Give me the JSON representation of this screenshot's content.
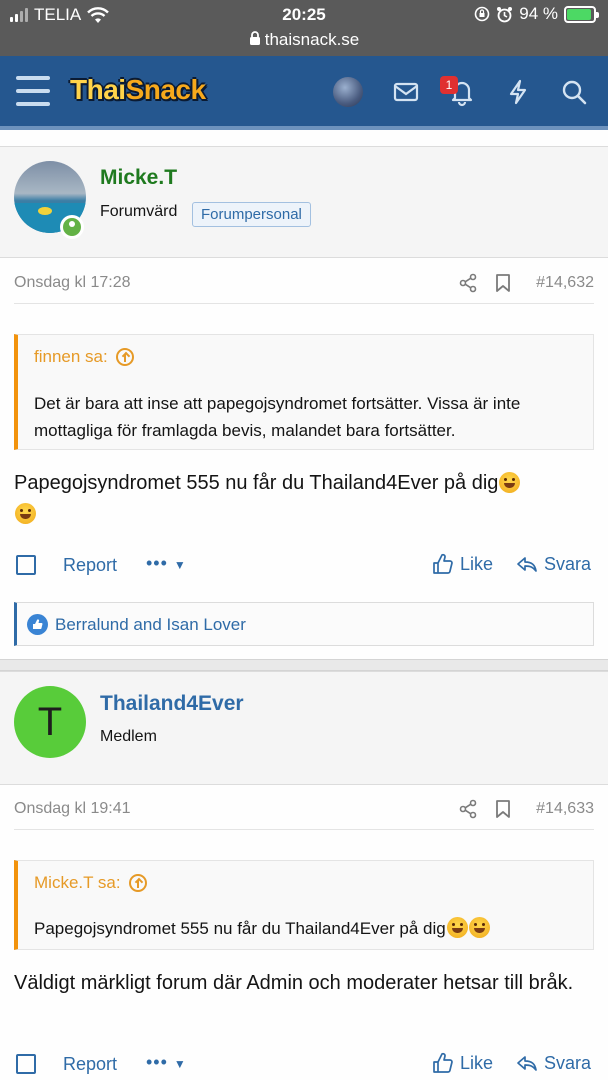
{
  "status_bar": {
    "carrier": "TELIA",
    "time": "20:25",
    "url": "thaisnack.se",
    "battery": "94 %"
  },
  "header": {
    "logo_part1": "Thai",
    "logo_part2": "Snack",
    "notification_count": "1"
  },
  "posts": [
    {
      "username": "Micke.T",
      "user_title": "Forumvärd",
      "badge": "Forumpersonal",
      "date": "Onsdag kl 17:28",
      "post_number": "#14,632",
      "quote_author": "finnen sa:",
      "quote_text": "Det är bara att inse att papegojsyndromet fortsätter. Vissa är inte mottagliga för framlagda bevis, malandet bara fortsätter.",
      "message": "Papegojsyndromet 555 nu får du Thailand4Ever på dig",
      "report_label": "Report",
      "more_label": "•••",
      "like_label": "Like",
      "reply_label": "Svara",
      "reactions": "Berralund and Isan Lover"
    },
    {
      "avatar_letter": "T",
      "username": "Thailand4Ever",
      "user_title": "Medlem",
      "date": "Onsdag kl 19:41",
      "post_number": "#14,633",
      "quote_author": "Micke.T sa:",
      "quote_text": "Papegojsyndromet 555 nu får du Thailand4Ever på dig",
      "message": "Väldigt märkligt forum där Admin och moderater hetsar till bråk.",
      "report_label": "Report",
      "more_label": "•••",
      "like_label": "Like",
      "reply_label": "Svara"
    }
  ],
  "colors": {
    "header_bg": "#25578f",
    "link_blue": "#2f6ba7",
    "quote_orange": "#e69a27",
    "username_green": "#1f7a1f",
    "username_blue": "#2f6ba7"
  }
}
